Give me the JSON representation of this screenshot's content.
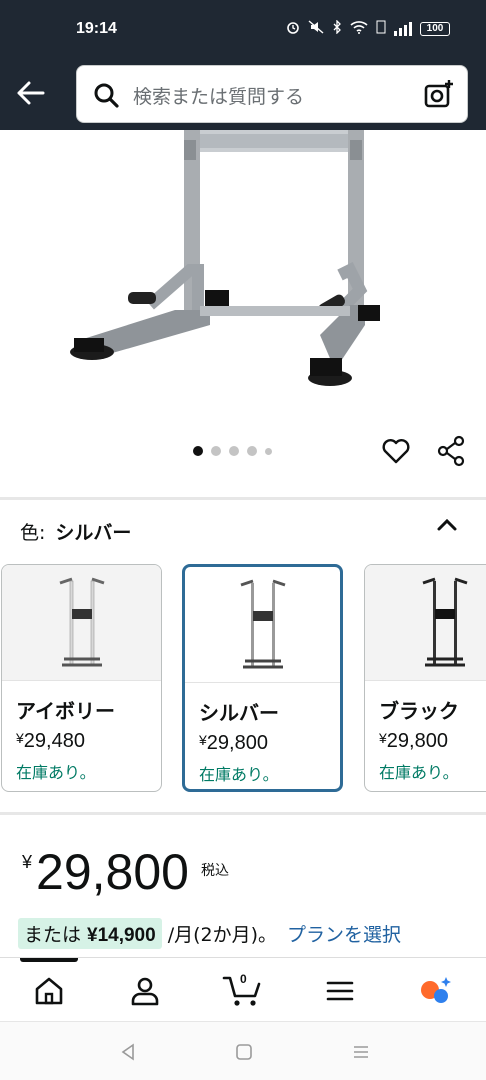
{
  "status_bar": {
    "time": "19:14",
    "battery": "100"
  },
  "search": {
    "placeholder": "検索または質問する"
  },
  "gallery": {
    "dot_count": 5,
    "active_index": 0
  },
  "color_section": {
    "label": "色:",
    "selected": "シルバー"
  },
  "variants": [
    {
      "name": "アイボリー",
      "yen": "¥",
      "price": "29,480",
      "stock": "在庫あり。",
      "frame_color": "#d8d8d8"
    },
    {
      "name": "シルバー",
      "yen": "¥",
      "price": "29,800",
      "stock": "在庫あり。",
      "frame_color": "#9a9a9a"
    },
    {
      "name": "ブラック",
      "yen": "¥",
      "price": "29,800",
      "stock": "在庫あり。",
      "frame_color": "#333333"
    }
  ],
  "price": {
    "yen": "¥",
    "amount": "29,800",
    "tax_label": "税込"
  },
  "installment": {
    "prefix": "または",
    "amount": "¥14,900",
    "suffix": "/月(2か月)。",
    "link": "プランを選択"
  },
  "cart": {
    "count": "0"
  },
  "colors": {
    "header_bg": "#1f2833",
    "accent_selected": "#2e6b96",
    "stock_green": "#007a64",
    "link_blue": "#2162a1",
    "installment_bg": "#d6f2e6"
  }
}
